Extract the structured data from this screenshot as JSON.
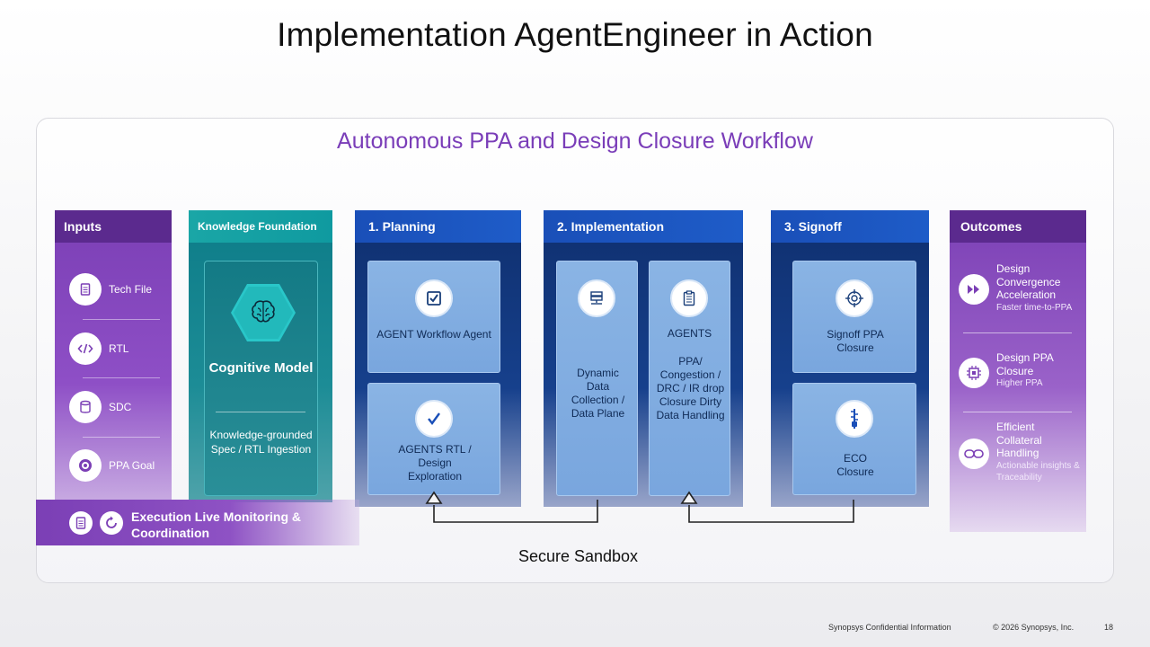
{
  "title": "Implementation AgentEngineer in Action",
  "subtitle": "Autonomous PPA and Design Closure Workflow",
  "columns": {
    "inputs": {
      "header": "Inputs",
      "items": [
        {
          "label": "Tech File",
          "icon": "document-icon"
        },
        {
          "label": "RTL",
          "icon": "code-icon"
        },
        {
          "label": "SDC",
          "icon": "database-icon"
        },
        {
          "label": "PPA Goal",
          "icon": "target-icon"
        }
      ]
    },
    "knowledge": {
      "header": "Knowledge Foundation",
      "model_title": "Cognitive Model",
      "description": "Knowledge-grounded Spec / RTL Ingestion",
      "icon": "brain-icon"
    },
    "planning": {
      "header": "1. Planning",
      "cards": [
        {
          "text": "AGENT Workflow Agent",
          "icon": "checkbox-icon"
        },
        {
          "text": "AGENTS RTL / Design Exploration",
          "icon": "checkmark-icon"
        }
      ]
    },
    "implementation": {
      "header": "2. Implementation",
      "cards": [
        {
          "text": "Dynamic Data Collection / Data Plane",
          "icon": "server-icon"
        },
        {
          "title": "AGENTS",
          "text": "PPA/ Congestion / DRC / IR drop Closure Dirty Data Handling",
          "icon": "clipboard-icon"
        }
      ]
    },
    "signoff": {
      "header": "3. Signoff",
      "cards": [
        {
          "text": "Signoff PPA Closure",
          "icon": "crosshair-icon"
        },
        {
          "text": "ECO Closure",
          "icon": "zipper-icon"
        }
      ]
    },
    "outcomes": {
      "header": "Outcomes",
      "items": [
        {
          "title": "Design Convergence Acceleration",
          "sub": "Faster time-to-PPA",
          "icon": "fast-forward-icon"
        },
        {
          "title": "Design PPA Closure",
          "sub": "Higher PPA",
          "icon": "chip-icon"
        },
        {
          "title": "Efficient Collateral Handling",
          "sub": "Actionable insights & Traceability",
          "icon": "link-icon"
        }
      ]
    }
  },
  "monitoring": {
    "label": "Execution Live Monitoring & Coordination",
    "icons": [
      "document-icon",
      "sync-icon"
    ]
  },
  "sandbox_label": "Secure Sandbox",
  "footer": {
    "confidential": "Synopsys Confidential Information",
    "copyright": "© 2026 Synopsys, Inc.",
    "page": "18"
  },
  "colors": {
    "purple": "#7b3fb5",
    "teal": "#1aa6a6",
    "navy": "#0f2f6e",
    "blue_header": "#1e5cc8",
    "card_blue": "#8ab4e4",
    "subtitle_purple": "#7a3db8"
  }
}
